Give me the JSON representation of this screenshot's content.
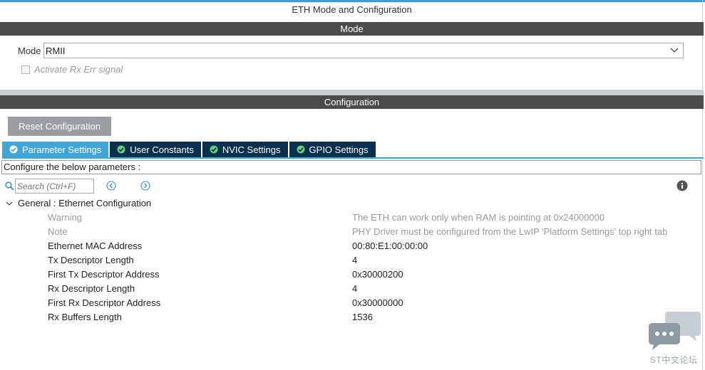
{
  "window": {
    "title": "ETH Mode and Configuration"
  },
  "mode_section": {
    "header": "Mode",
    "mode_label": "Mode",
    "mode_value": "RMII",
    "rx_err_label": "Activate Rx Err signal",
    "rx_err_checked": false
  },
  "config_section": {
    "header": "Configuration",
    "reset_button": "Reset Configuration",
    "tabs": [
      {
        "label": "Parameter Settings",
        "active": true,
        "icon": "check-circle-icon"
      },
      {
        "label": "User Constants",
        "active": false,
        "icon": "check-circle-icon"
      },
      {
        "label": "NVIC Settings",
        "active": false,
        "icon": "check-circle-icon"
      },
      {
        "label": "GPIO Settings",
        "active": false,
        "icon": "check-circle-icon"
      }
    ],
    "instruction": "Configure the below parameters :",
    "search_placeholder": "Search (Ctrl+F)",
    "group_title": "General : Ethernet Configuration",
    "parameters": [
      {
        "name": "Warning",
        "value": "The ETH can work only when RAM is pointing at 0x24000000",
        "muted": true
      },
      {
        "name": "Note",
        "value": "PHY Driver must be configured from the LwIP 'Platform Settings' top right tab",
        "muted": true
      },
      {
        "name": "Ethernet MAC Address",
        "value": "00:80:E1:00:00:00",
        "muted": false
      },
      {
        "name": "Tx Descriptor Length",
        "value": "4",
        "muted": false
      },
      {
        "name": "First Tx Descriptor Address",
        "value": "0x30000200",
        "muted": false
      },
      {
        "name": "Rx Descriptor Length",
        "value": "4",
        "muted": false
      },
      {
        "name": "First Rx Descriptor Address",
        "value": "0x30000000",
        "muted": false
      },
      {
        "name": "Rx Buffers Length",
        "value": "1536",
        "muted": false
      }
    ]
  },
  "watermark": {
    "text": "ST中文论坛"
  },
  "colors": {
    "accent": "#3fa6d8",
    "tab_inactive": "#0b2f4e",
    "section_bar": "#4b4b4b",
    "reset_button": "#9a9ea2"
  }
}
